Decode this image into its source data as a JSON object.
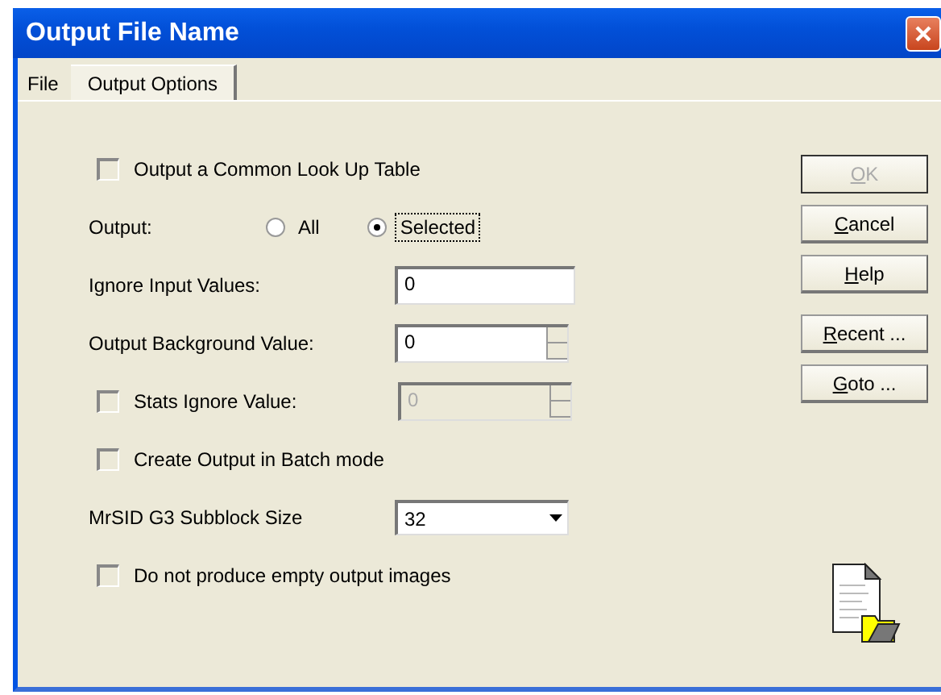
{
  "window": {
    "title": "Output File Name"
  },
  "tabs": [
    {
      "label": "File",
      "selected": false
    },
    {
      "label": "Output Options",
      "selected": true
    }
  ],
  "options": [
    {
      "kind": "checkbox",
      "label": "Output a Common Look Up Table",
      "checked": false
    },
    {
      "kind": "radio",
      "label": "Output:",
      "choices": [
        {
          "label": "All",
          "selected": false
        },
        {
          "label": "Selected",
          "selected": true
        }
      ]
    },
    {
      "kind": "text",
      "label": "Ignore Input Values:",
      "value": "0"
    },
    {
      "kind": "spinner",
      "label": "Output Background Value:",
      "value": "0",
      "disabled": false
    },
    {
      "kind": "check-spinner",
      "label": "Stats Ignore Value:",
      "checked": false,
      "value": "0",
      "disabled": true
    },
    {
      "kind": "checkbox",
      "label": "Create Output in Batch mode",
      "checked": false
    },
    {
      "kind": "dropdown",
      "label": "MrSID G3 Subblock Size",
      "value": "32"
    },
    {
      "kind": "checkbox",
      "label": "Do not produce empty output images",
      "checked": false
    }
  ],
  "buttons": [
    {
      "label": "OK",
      "disabled": true
    },
    {
      "label": "Cancel",
      "disabled": false
    },
    {
      "label": "Help",
      "disabled": false
    }
  ],
  "more_buttons": [
    {
      "label": "Recent ...",
      "disabled": false
    },
    {
      "label": "Goto ...",
      "disabled": false
    }
  ]
}
